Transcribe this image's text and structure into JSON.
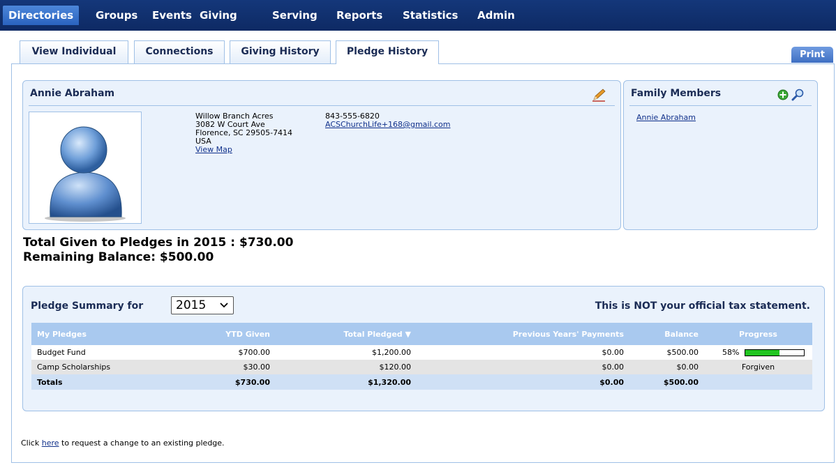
{
  "nav": {
    "items": [
      "Directories",
      "Groups",
      "Events",
      "Giving",
      "Serving",
      "Reports",
      "Statistics",
      "Admin"
    ],
    "active": "Directories"
  },
  "tabs": [
    "View Individual",
    "Connections",
    "Giving History",
    "Pledge History"
  ],
  "active_tab": "Pledge History",
  "print_label": "Print",
  "person": {
    "name": "Annie Abraham",
    "address_lines": [
      "Willow Branch Acres",
      "3082 W Court Ave",
      "Florence, SC 29505-7414",
      "USA"
    ],
    "view_map": "View Map",
    "phone": "843-555-6820",
    "email": "ACSChurchLife+168@gmail.com"
  },
  "family": {
    "title": "Family Members",
    "members": [
      "Annie Abraham"
    ]
  },
  "totals": {
    "given": "Total Given to Pledges in 2015 : $730.00",
    "remaining": "Remaining Balance: $500.00"
  },
  "summary": {
    "title": "Pledge Summary for",
    "year": "2015",
    "tax_note": "This is NOT your official tax statement.",
    "columns": [
      "My Pledges",
      "YTD Given",
      "Total Pledged",
      "Previous Years' Payments",
      "Balance",
      "Progress"
    ],
    "sort_indicator": "▼",
    "rows": [
      {
        "name": "Budget Fund",
        "ytd": "$700.00",
        "pledged": "$1,200.00",
        "prev": "$0.00",
        "balance": "$500.00",
        "progress_label": "58%",
        "progress": 58
      },
      {
        "name": "Camp Scholarships",
        "ytd": "$30.00",
        "pledged": "$120.00",
        "prev": "$0.00",
        "balance": "$0.00",
        "progress_label": "Forgiven"
      }
    ],
    "totals_row": {
      "name": "Totals",
      "ytd": "$730.00",
      "pledged": "$1,320.00",
      "prev": "$0.00",
      "balance": "$500.00"
    }
  },
  "footer": {
    "prefix": "Click",
    "link": "here",
    "suffix": "to request a change to an existing pledge."
  },
  "colors": {
    "nav_bg": "#0e2a64",
    "active_nav": "#2a63bf",
    "panel_bg": "#eaf2fc",
    "header_row": "#a9c9ef",
    "progress_fill": "#22c521"
  }
}
